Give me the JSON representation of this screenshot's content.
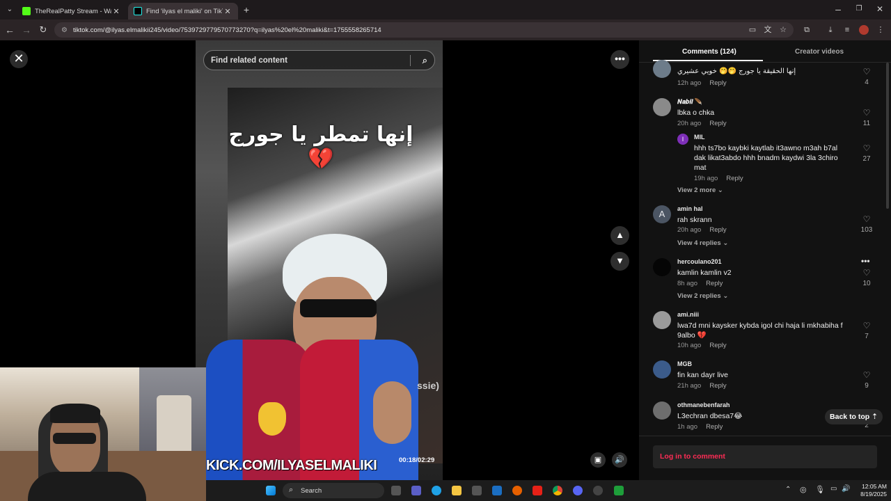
{
  "browser": {
    "tabs": [
      {
        "title": "TheRealPatty Stream - Watch Li",
        "active": false
      },
      {
        "title": "Find 'ilyas el maliki' on TikTok |",
        "active": true
      }
    ],
    "new_tab_label": "+",
    "url": "tiktok.com/@ilyas.elmalikii245/video/7539729779570773270?q=ilyas%20el%20maliki&t=1755558265714"
  },
  "video": {
    "search_placeholder": "Find related content",
    "overlay_caption": "إنها تمطر يا جورج 💔",
    "watermark": "KICK.COM/ILYASELMALIKI",
    "time": "00:18/02:29",
    "side_text": "ssie)"
  },
  "panel": {
    "tab_comments": "Comments (124)",
    "tab_creator": "Creator videos",
    "reply_label": "Reply",
    "comments": [
      {
        "user": "",
        "text": "إنها الحقيقة يا جورج 🤭🤭 خويي عشيري",
        "time": "12h ago",
        "likes": "4"
      },
      {
        "user": "𝑵𝒂𝒃𝒊𝒍 🪶",
        "text": "lbka o chka",
        "time": "20h ago",
        "likes": "11"
      },
      {
        "user": "MIL",
        "text": "hhh ts7bo kaybki kaytlab it3awno m3ah b7al dak likat3abdo hhh bnadm kaydwi 3la 3chiro mat",
        "time": "19h ago",
        "likes": "27"
      },
      {
        "user": "amin hal",
        "text": "rah skrann",
        "time": "20h ago",
        "likes": "103"
      },
      {
        "user": "hercoulano201",
        "text": "kamlin kamlin v2",
        "time": "8h ago",
        "likes": "10"
      },
      {
        "user": "ami.niii",
        "text": "lwa7d mni kaysker kybda igol chi haja li mkhabiha f 9albo 💔",
        "time": "10h ago",
        "likes": "7"
      },
      {
        "user": "MGB",
        "text": "fin kan dayr live",
        "time": "21h ago",
        "likes": "9"
      },
      {
        "user": "othmanebenfarah",
        "text": "L3echran dbesa7😂",
        "time": "1h ago",
        "likes": "2"
      }
    ],
    "view_more_1": "View 2 more",
    "view_replies_amin": "View 4 replies",
    "view_replies_herc": "View 2 replies",
    "avatar_letter": "A",
    "avatar_reply_letter": "I",
    "back_to_top": "Back to top",
    "login": "Log in to comment"
  },
  "taskbar": {
    "search_label": "Search",
    "time": "12:05 AM",
    "date": "8/19/2025"
  },
  "colors": {
    "tiktok_red": "#fe2c55",
    "panel_bg": "#121212",
    "chrome_bg": "#1e1a1c"
  }
}
